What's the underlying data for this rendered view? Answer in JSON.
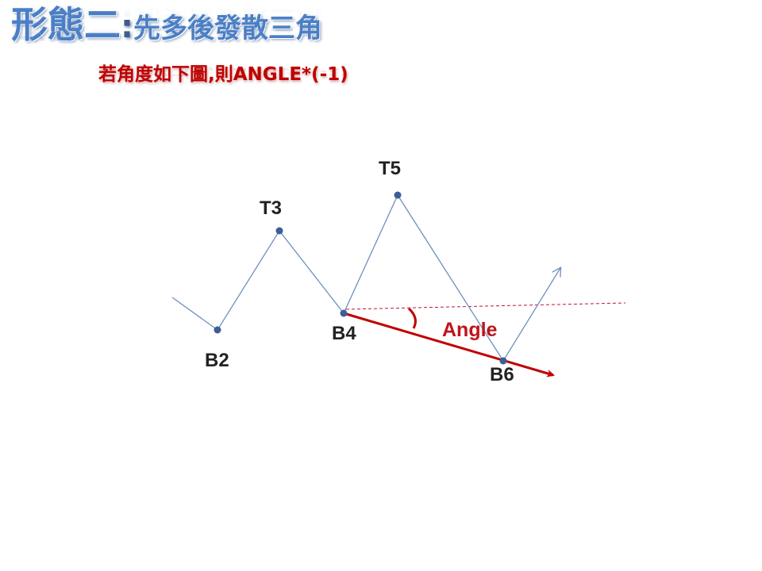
{
  "slide": {
    "title_part1": "形態二",
    "title_colon": ":",
    "title_part2": "先多後發散三角",
    "subtitle": "若角度如下圖,則ANGLE*(-1)"
  },
  "diagram": {
    "points": [
      {
        "label": "B2"
      },
      {
        "label": "T3"
      },
      {
        "label": "B4"
      },
      {
        "label": "T5"
      },
      {
        "label": "B6"
      }
    ],
    "angle_label": "Angle",
    "colors": {
      "zigzag": "#6f8fbf",
      "node": "#3b5f95",
      "arrow": "#c00000",
      "reference": "#c0142c"
    }
  }
}
